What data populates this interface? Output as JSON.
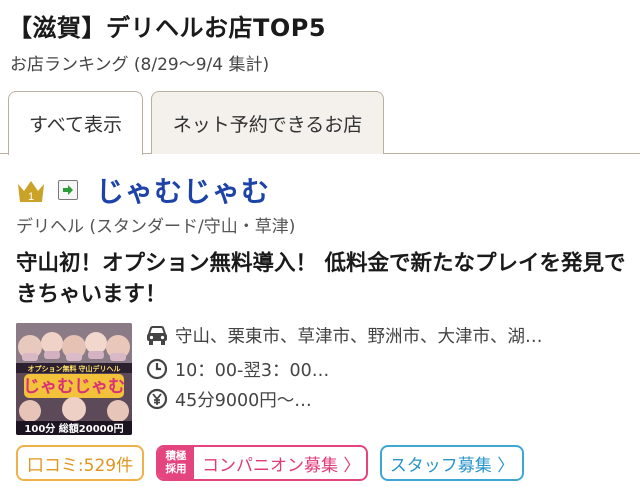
{
  "header": {
    "title": "【滋賀】デリヘルお店TOP5",
    "subtitle": "お店ランキング (8/29〜9/4 集計)"
  },
  "tabs": [
    {
      "label": "すべて表示",
      "active": true
    },
    {
      "label": "ネット予約できるお店",
      "active": false
    }
  ],
  "shop": {
    "rank": "1",
    "name": "じゃむじゃむ",
    "genre": "デリヘル (スタンダード/守山・草津)",
    "catch_copy": "守山初！オプション無料導入！ 低料金で新たなプレイを発見できちゃいます！",
    "area": "守山、栗東市、草津市、野洲市、大津市、湖…",
    "hours": "10：00-翌3：00…",
    "price": "45分9000円〜…",
    "thumbnail_text": "100分 総額20000円"
  },
  "badges": {
    "review": "口コミ:529件",
    "companion_tag_line1": "積極",
    "companion_tag_line2": "採用",
    "companion": "コンパニオン募集 〉",
    "staff": "スタッフ募集 〉"
  },
  "colors": {
    "shop_name": "#1d43a8",
    "crown": "#c9a227",
    "review": "#f0b248",
    "companion": "#e5457f",
    "staff": "#3ea6d4"
  }
}
